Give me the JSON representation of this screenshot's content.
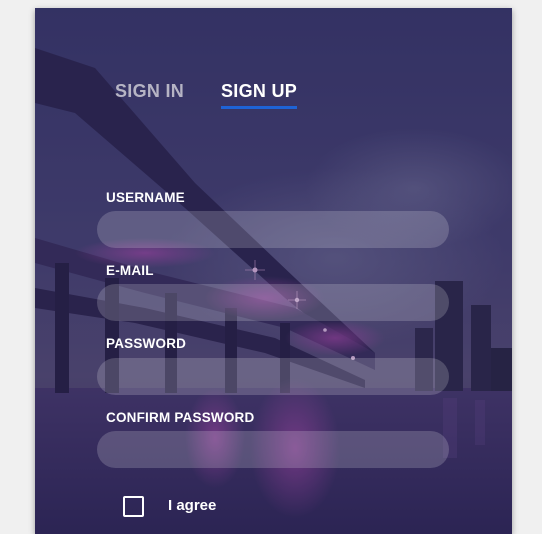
{
  "tabs": {
    "sign_in": "SIGN IN",
    "sign_up": "SIGN UP",
    "active": "sign_up"
  },
  "form": {
    "username": {
      "label": "USERNAME",
      "value": ""
    },
    "email": {
      "label": "E-MAIL",
      "value": ""
    },
    "password": {
      "label": "PASSWORD",
      "value": ""
    },
    "confirm_password": {
      "label": "CONFIRM PASSWORD",
      "value": ""
    },
    "agree": {
      "label": "I agree",
      "checked": false
    }
  },
  "colors": {
    "tab_underline": "#1e63d6",
    "overlay": "#28265c"
  }
}
